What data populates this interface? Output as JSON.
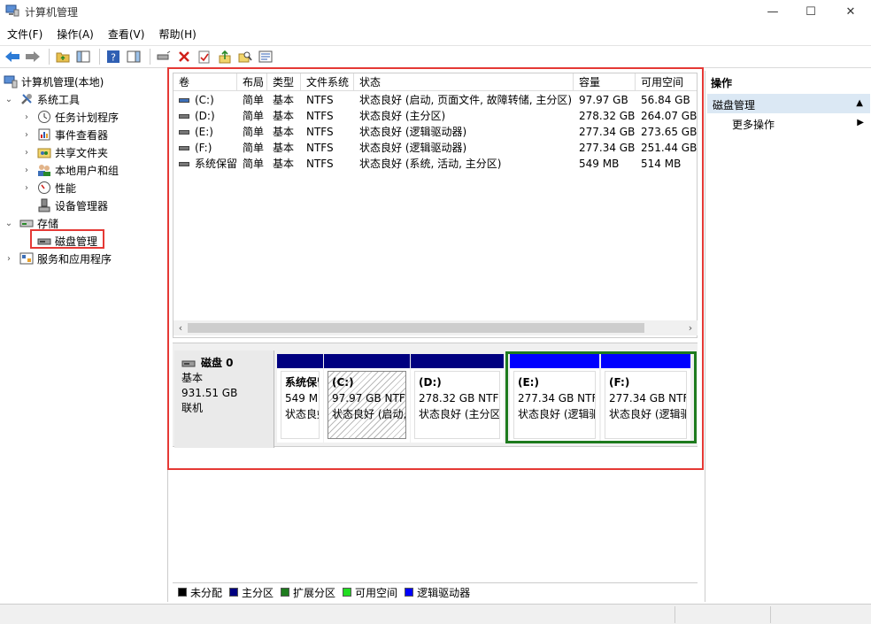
{
  "window": {
    "title": "计算机管理",
    "min": "—",
    "max": "☐",
    "close": "✕"
  },
  "menu": [
    "文件(F)",
    "操作(A)",
    "查看(V)",
    "帮助(H)"
  ],
  "tree": {
    "root": "计算机管理(本地)",
    "system_tools": "系统工具",
    "task_scheduler": "任务计划程序",
    "event_viewer": "事件查看器",
    "shared_folders": "共享文件夹",
    "local_users": "本地用户和组",
    "performance": "性能",
    "device_manager": "设备管理器",
    "storage": "存储",
    "disk_management": "磁盘管理",
    "services_apps": "服务和应用程序"
  },
  "volumes": {
    "headers": [
      "卷",
      "布局",
      "类型",
      "文件系统",
      "状态",
      "容量",
      "可用空间"
    ],
    "rows": [
      [
        "(C:)",
        "简单",
        "基本",
        "NTFS",
        "状态良好 (启动, 页面文件, 故障转储, 主分区)",
        "97.97 GB",
        "56.84 GB"
      ],
      [
        "(D:)",
        "简单",
        "基本",
        "NTFS",
        "状态良好 (主分区)",
        "278.32 GB",
        "264.07 GB"
      ],
      [
        "(E:)",
        "简单",
        "基本",
        "NTFS",
        "状态良好 (逻辑驱动器)",
        "277.34 GB",
        "273.65 GB"
      ],
      [
        "(F:)",
        "简单",
        "基本",
        "NTFS",
        "状态良好 (逻辑驱动器)",
        "277.34 GB",
        "251.44 GB"
      ],
      [
        "系统保留",
        "简单",
        "基本",
        "NTFS",
        "状态良好 (系统, 活动, 主分区)",
        "549 MB",
        "514 MB"
      ]
    ]
  },
  "disk": {
    "name": "磁盘 0",
    "type": "基本",
    "size": "931.51 GB",
    "state": "联机",
    "partitions": [
      {
        "name": "系统保留",
        "size": "549 M",
        "status": "状态良好"
      },
      {
        "name": "(C:)",
        "size": "97.97 GB NTFS",
        "status": "状态良好 (启动,页"
      },
      {
        "name": "(D:)",
        "size": "278.32 GB NTFS",
        "status": "状态良好 (主分区)"
      },
      {
        "name": "(E:)",
        "size": "277.34 GB NTFS",
        "status": "状态良好 (逻辑驱"
      },
      {
        "name": "(F:)",
        "size": "277.34 GB NTFS",
        "status": "状态良好 (逻辑驱"
      }
    ]
  },
  "legend": [
    "未分配",
    "主分区",
    "扩展分区",
    "可用空间",
    "逻辑驱动器"
  ],
  "colors": {
    "unallocated": "#000000",
    "primary": "#000080",
    "extended": "#1e7b1e",
    "free": "#22dd22",
    "logical": "#0000ff",
    "accent_red": "#e53935"
  },
  "actions": {
    "header": "操作",
    "section": "磁盘管理",
    "more": "更多操作"
  }
}
